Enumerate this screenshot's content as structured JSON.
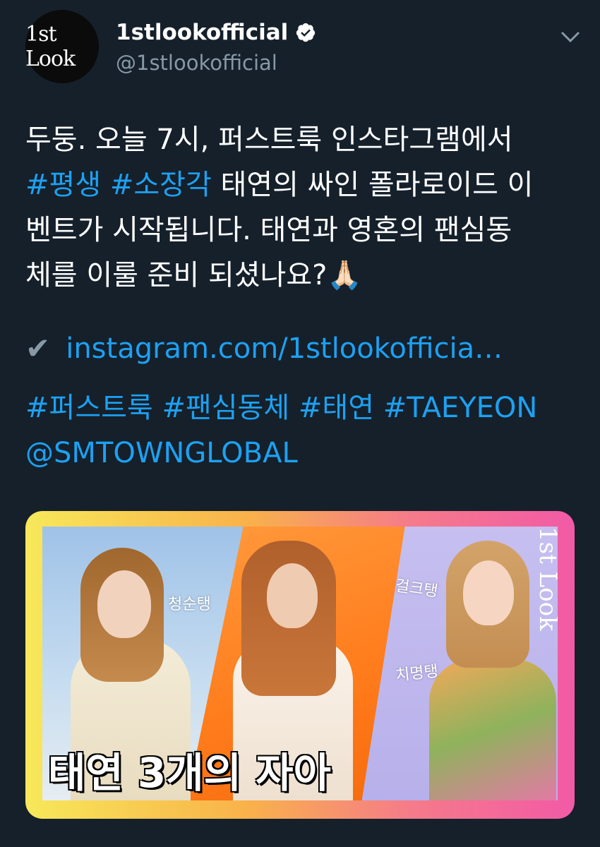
{
  "account": {
    "avatar_text": "1st Look",
    "display_name": "1stlookofficial",
    "handle": "@1stlookofficial",
    "verified": true
  },
  "icons": {
    "verified": "verified-badge-icon",
    "menu": "chevron-down-icon",
    "check": "heavy-check-icon"
  },
  "tweet": {
    "line1": "두둥. 오늘 7시, 퍼스트룩 인스타그램에서",
    "tag_pyeongsaeng": "#평생",
    "tag_sojanggak": "#소장각",
    "line2_rest": " 태연의 싸인 폴라로이드 이",
    "line3": "벤트가 시작됩니다. 태연과 영혼의 팬심동",
    "line4": "체를 이룰 준비 되셨나요?",
    "emoji": "🙏🏻",
    "check_mark": "✔",
    "link": "instagram.com/1stlookofficia…",
    "hashtags": [
      "#퍼스트룩",
      "#팬심동체",
      "#태연",
      "#TAEYEON"
    ],
    "mention": "@SMTOWNGLOBAL"
  },
  "media": {
    "caption": "태연 3개의 자아",
    "label_1": "청순탱",
    "label_2": "걸크탱",
    "label_3": "치명탱",
    "brand": "1st Look"
  },
  "colors": {
    "background": "#15202b",
    "link": "#1da1f2",
    "secondary": "#8899a6",
    "text": "#ffffff"
  }
}
